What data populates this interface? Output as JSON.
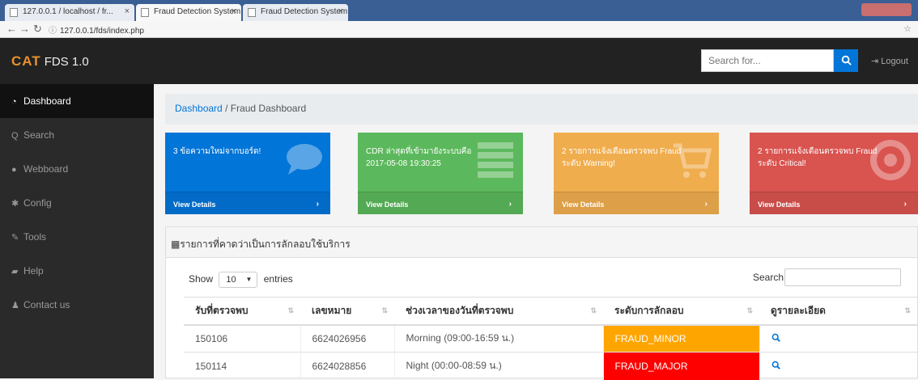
{
  "browser": {
    "tabs": [
      {
        "label": "127.0.0.1 / localhost / fr..."
      },
      {
        "label": "Fraud Detection System"
      },
      {
        "label": "Fraud Detection System"
      }
    ],
    "url_protocol": "ⓘ",
    "url": "127.0.0.1/fds/index.php"
  },
  "navbar": {
    "logo": "CAT",
    "version": "FDS 1.0",
    "search_placeholder": "Search for...",
    "logout_label": "Logout"
  },
  "sidebar": {
    "items": [
      {
        "label": "Dashboard",
        "icon": "dashboard-icon"
      },
      {
        "label": "Search",
        "icon": "search-icon"
      },
      {
        "label": "Webboard",
        "icon": "comment-icon"
      },
      {
        "label": "Config",
        "icon": "gear-icon"
      },
      {
        "label": "Tools",
        "icon": "wrench-icon"
      },
      {
        "label": "Help",
        "icon": "book-icon"
      },
      {
        "label": "Contact us",
        "icon": "user-icon"
      }
    ]
  },
  "breadcrumb": {
    "root": "Dashboard",
    "separator": "/",
    "current": "Fraud Dashboard"
  },
  "cards": [
    {
      "text": "3 ข้อความใหม่จากบอร์ด!",
      "footer": "View Details",
      "color": "#0275d8",
      "icon": "comments-icon"
    },
    {
      "text": "CDR ล่าสุดที่เข้ามายังระบบคือ 2017-05-08 19:30:25",
      "footer": "View Details",
      "color": "#5cb85c",
      "icon": "list-icon"
    },
    {
      "text": "2 รายการแจ้งเตือนตรวจพบ Fraud ระดับ Warning!",
      "footer": "View Details",
      "color": "#f0ad4e",
      "icon": "cart-icon"
    },
    {
      "text": "2 รายการแจ้งเตือนตรวจพบ Fraud ระดับ Critical!",
      "footer": "View Details",
      "color": "#d9534f",
      "icon": "lifebuoy-icon"
    }
  ],
  "table": {
    "title": "รายการที่คาดว่าเป็นการลักลอบใช้บริการ",
    "show_label": "Show",
    "entries_value": "10",
    "entries_label": "entries",
    "search_label": "Search:",
    "columns": [
      "รับที่ตรวจพบ",
      "เลขหมาย",
      "ช่วงเวลาของวันที่ตรวจพบ",
      "ระดับการลักลอบ",
      "ดูรายละเอียด"
    ],
    "rows": [
      {
        "date": "150106",
        "number": "6624026956",
        "period": "Morning (09:00-16:59 น.)",
        "level": "FRAUD_MINOR"
      },
      {
        "date": "150114",
        "number": "6624028856",
        "period": "Night (00:00-08:59 น.)",
        "level": "FRAUD_MAJOR"
      }
    ]
  }
}
